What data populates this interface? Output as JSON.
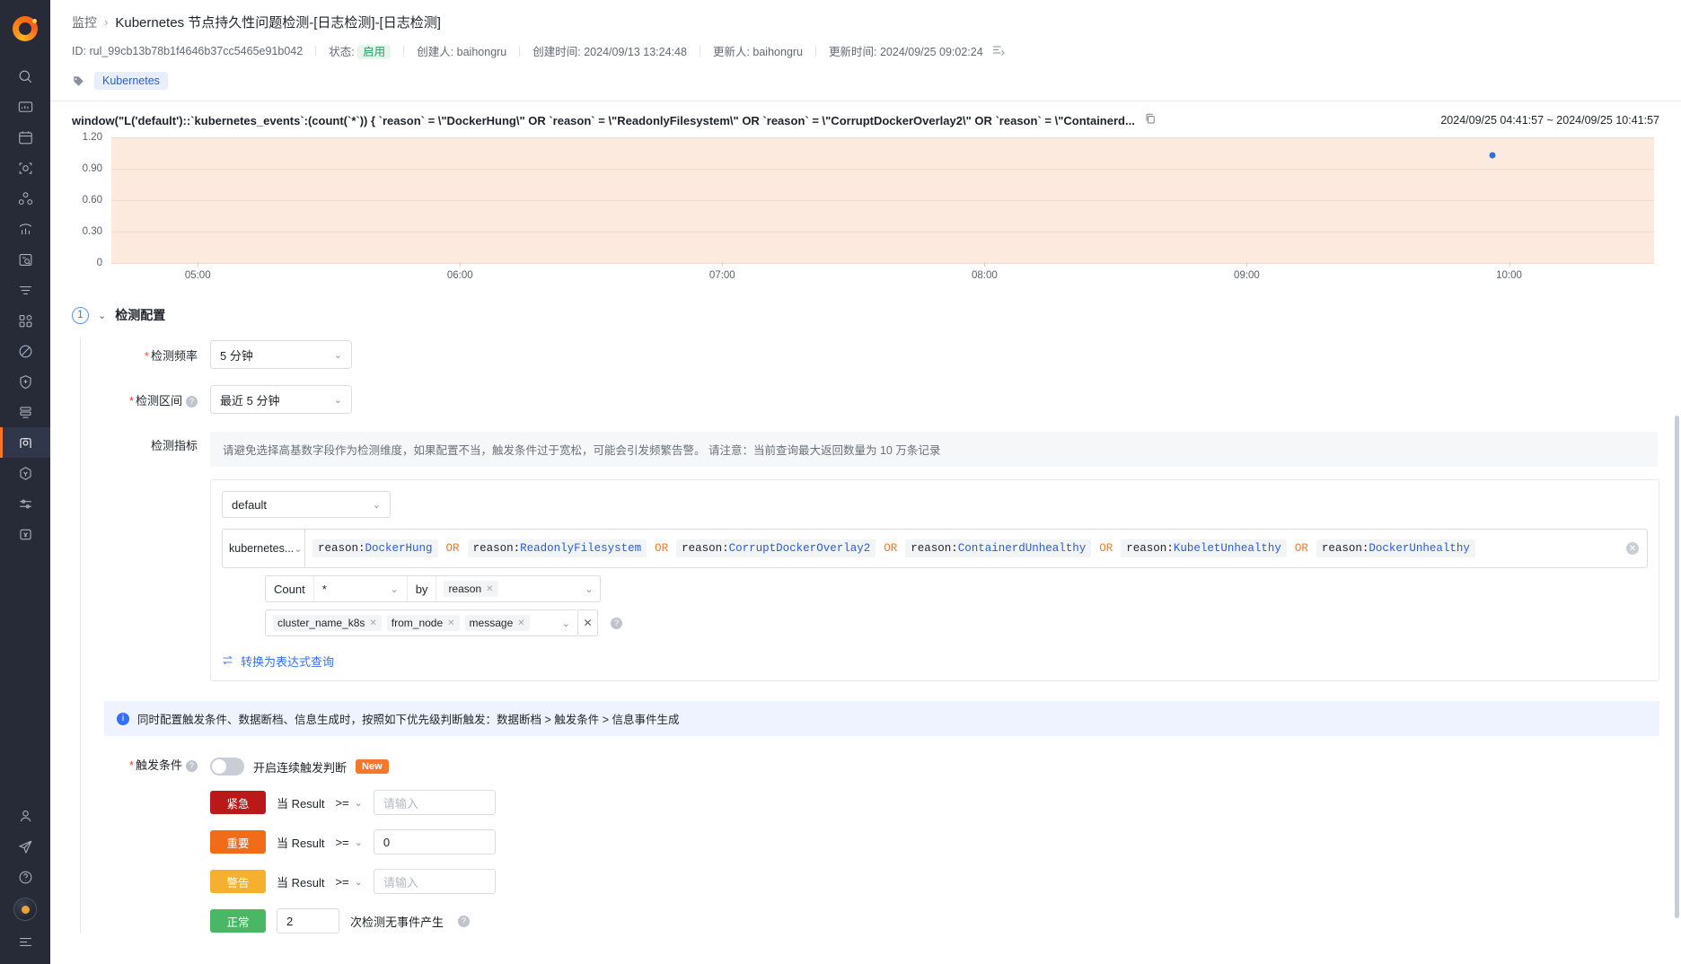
{
  "sidebar": {
    "logo_name": "app-logo",
    "items": [
      {
        "name": "search-icon",
        "label": "搜索"
      },
      {
        "name": "dashboard-icon",
        "label": "仪表盘"
      },
      {
        "name": "calendar-icon",
        "label": "日历"
      },
      {
        "name": "scan-icon",
        "label": "扫描"
      },
      {
        "name": "topology-icon",
        "label": "拓扑"
      },
      {
        "name": "chart-icon",
        "label": "指标"
      },
      {
        "name": "log-search-icon",
        "label": "日志检索"
      },
      {
        "name": "filter-icon",
        "label": "过滤"
      },
      {
        "name": "apps-grid-icon",
        "label": "应用"
      },
      {
        "name": "forbidden-icon",
        "label": "禁用"
      },
      {
        "name": "shield-plus-icon",
        "label": "安全"
      },
      {
        "name": "layers-icon",
        "label": "资源"
      },
      {
        "name": "monitor-camera-icon",
        "label": "监控",
        "active": true
      },
      {
        "name": "hexagon-y-icon",
        "label": "服务"
      },
      {
        "name": "sliders-icon",
        "label": "设置"
      },
      {
        "name": "yuan-box-icon",
        "label": "费用"
      }
    ],
    "bottom_items": [
      {
        "name": "user-icon",
        "label": "用户"
      },
      {
        "name": "send-icon",
        "label": "发送"
      },
      {
        "name": "help-icon",
        "label": "帮助"
      },
      {
        "name": "avatar",
        "label": "头像"
      },
      {
        "name": "collapse-sidebar-icon",
        "label": "收起"
      }
    ]
  },
  "header": {
    "breadcrumb_root": "监控",
    "breadcrumb_sep": "›",
    "title": "Kubernetes 节点持久性问题检测-[日志检测]-[日志检测]",
    "meta": {
      "id_label": "ID:",
      "id_value": "rul_99cb13b78b1f4646b37cc5465e91b042",
      "status_label": "状态:",
      "status_value": "启用",
      "creator_label": "创建人:",
      "creator_value": "baihongru",
      "created_label": "创建时间:",
      "created_value": "2024/09/13 13:24:48",
      "updater_label": "更新人:",
      "updater_value": "baihongru",
      "updated_label": "更新时间:",
      "updated_value": "2024/09/25 09:02:24"
    },
    "tag": "Kubernetes"
  },
  "query": {
    "text": "window(\"L('default')::`kubernetes_events`:(count(`*`)) { `reason` = \\\"DockerHung\\\" OR `reason` = \\\"ReadonlyFilesystem\\\" OR `reason` = \\\"CorruptDockerOverlay2\\\" OR `reason` = \\\"Containerd...",
    "copy_icon": "copy-icon",
    "time_range": "2024/09/25 04:41:57 ~ 2024/09/25 10:41:57"
  },
  "chart_data": {
    "type": "scatter",
    "title": "",
    "xlabel": "",
    "ylabel": "",
    "ylim": [
      0,
      1.2
    ],
    "yticks": [
      "1.20",
      "0.90",
      "0.60",
      "0.30",
      "0"
    ],
    "ytick_values": [
      1.2,
      0.9,
      0.6,
      0.3,
      0
    ],
    "xticks": [
      "05:00",
      "06:00",
      "07:00",
      "08:00",
      "09:00",
      "10:00"
    ],
    "x_start": "04:41:57",
    "x_end": "10:41:57",
    "grid": true,
    "legend": "none",
    "plot_bg": "#fdeade",
    "point_color": "#2a6fe0",
    "points": [
      {
        "x": "10:09",
        "y": 1.0,
        "x_frac": 0.895,
        "y_frac": 1.0
      }
    ]
  },
  "section": {
    "step_number": "1",
    "title": "检测配置",
    "freq": {
      "label": "检测频率",
      "required": true,
      "value": "5 分钟"
    },
    "interval": {
      "label": "检测区间",
      "required": true,
      "has_help": true,
      "value": "最近 5 分钟"
    },
    "metric": {
      "label": "检测指标",
      "notice": "请避免选择高基数字段作为检测维度，如果配置不当，触发条件过于宽松，可能会引发频繁告警。 请注意：当前查询最大返回数量为 10 万条记录"
    },
    "query_builder": {
      "workspace": "default",
      "source": "kubernetes...",
      "terms": [
        {
          "key": "reason",
          "value": "DockerHung"
        },
        {
          "key": "reason",
          "value": "ReadonlyFilesystem"
        },
        {
          "key": "reason",
          "value": "CorruptDockerOverlay2"
        },
        {
          "key": "reason",
          "value": "ContainerdUnhealthy"
        },
        {
          "key": "reason",
          "value": "KubeletUnhealthy"
        },
        {
          "key": "reason",
          "value": "DockerUnhealthy"
        }
      ],
      "operator": "OR",
      "agg_label": "Count",
      "agg_field": "*",
      "by_label": "by",
      "by_tags": [
        "reason"
      ],
      "dim_tags": [
        "cluster_name_k8s",
        "from_node",
        "message"
      ],
      "convert_link": "转换为表达式查询"
    },
    "info_bar": "同时配置触发条件、数据断档、信息生成时，按照如下优先级判断触发：数据断档 > 触发条件 > 信息事件生成",
    "trigger": {
      "label": "触发条件",
      "required": true,
      "has_help": true,
      "toggle_on": false,
      "toggle_label": "开启连续触发判断",
      "badge": "New",
      "when_label": "当 Result",
      "rows": [
        {
          "severity": "紧急",
          "color": "#bb1919",
          "op": ">=",
          "value": "",
          "placeholder": "请输入"
        },
        {
          "severity": "重要",
          "color": "#f26b18",
          "op": ">=",
          "value": "0",
          "placeholder": "请输入"
        },
        {
          "severity": "警告",
          "color": "#f5b02e",
          "op": ">=",
          "value": "",
          "placeholder": "请输入"
        }
      ],
      "normal": {
        "severity": "正常",
        "color": "#48b865",
        "count": "2",
        "suffix": "次检测无事件产生"
      }
    }
  }
}
